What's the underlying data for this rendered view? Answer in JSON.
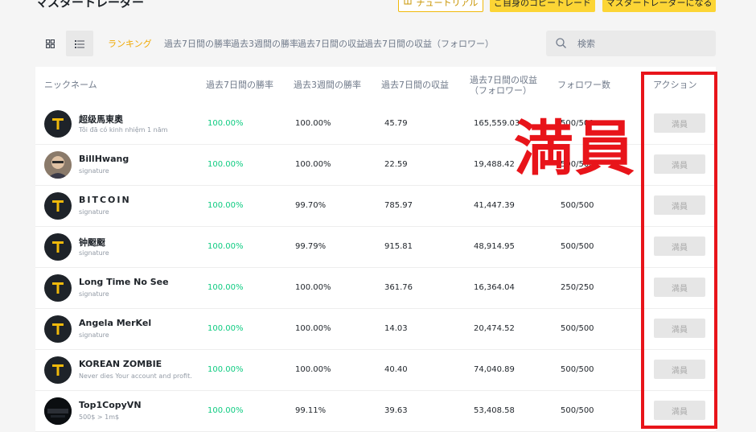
{
  "page_title": "マスタートレーダー",
  "top_buttons": {
    "tutorial": "チュートリアル",
    "guide": "ご自身のコピートレード",
    "become": "マスタートレーダーになる"
  },
  "view_toggle": {
    "grid_icon": "grid-icon",
    "list_icon": "list-icon",
    "selected": "list"
  },
  "nav_tabs": [
    "ランキング",
    "過去7日間の勝率",
    "過去3週間の勝率",
    "過去7日間の収益",
    "過去7日間の収益（フォロワー）"
  ],
  "search": {
    "placeholder": "検索"
  },
  "table": {
    "headers": [
      "ニックネーム",
      "過去7日間の勝率",
      "過去3週間の勝率",
      "過去7日間の収益",
      "過去7日間の収益（フォロワー）",
      "フォロワー数",
      "アクション"
    ],
    "rows": [
      {
        "name": "超级馬東奧",
        "sub": "Tôi đã có kinh nhiệm 1 năm",
        "win7": "100.00%",
        "win3w": "100.00%",
        "profit7": "45.79",
        "follower_profit": "165,559.03",
        "followers": "500/500",
        "action": "満員"
      },
      {
        "name": "BillHwang",
        "sub": "signature",
        "win7": "100.00%",
        "win3w": "100.00%",
        "profit7": "22.59",
        "follower_profit": "19,488.42",
        "followers": "500/500",
        "action": "満員"
      },
      {
        "name": "BITCOIN",
        "sub": "signature",
        "win7": "100.00%",
        "win3w": "99.70%",
        "profit7": "785.97",
        "follower_profit": "41,447.39",
        "followers": "500/500",
        "action": "満員"
      },
      {
        "name": "钟颬颬",
        "sub": "signature",
        "win7": "100.00%",
        "win3w": "99.79%",
        "profit7": "915.81",
        "follower_profit": "48,914.95",
        "followers": "500/500",
        "action": "満員"
      },
      {
        "name": "Long Time No See",
        "sub": "signature",
        "win7": "100.00%",
        "win3w": "100.00%",
        "profit7": "361.76",
        "follower_profit": "16,364.04",
        "followers": "250/250",
        "action": "満員"
      },
      {
        "name": "Angela MerKel",
        "sub": "signature",
        "win7": "100.00%",
        "win3w": "100.00%",
        "profit7": "14.03",
        "follower_profit": "20,474.52",
        "followers": "500/500",
        "action": "満員"
      },
      {
        "name": "KOREAN ZOMBIE",
        "sub": "Never dies Your account and profit.",
        "win7": "100.00%",
        "win3w": "100.00%",
        "profit7": "40.40",
        "follower_profit": "74,040.89",
        "followers": "500/500",
        "action": "満員"
      },
      {
        "name": "Top1CopyVN",
        "sub": "500$ > 1m$",
        "win7": "100.00%",
        "win3w": "99.11%",
        "profit7": "39.63",
        "follower_profit": "53,408.58",
        "followers": "500/500",
        "action": "満員"
      }
    ]
  },
  "annotation": {
    "text": "満員",
    "color": "#e8141a"
  },
  "colors": {
    "accent": "#fcd535",
    "positive": "#0ecb81",
    "tab_active": "#f0a800"
  }
}
